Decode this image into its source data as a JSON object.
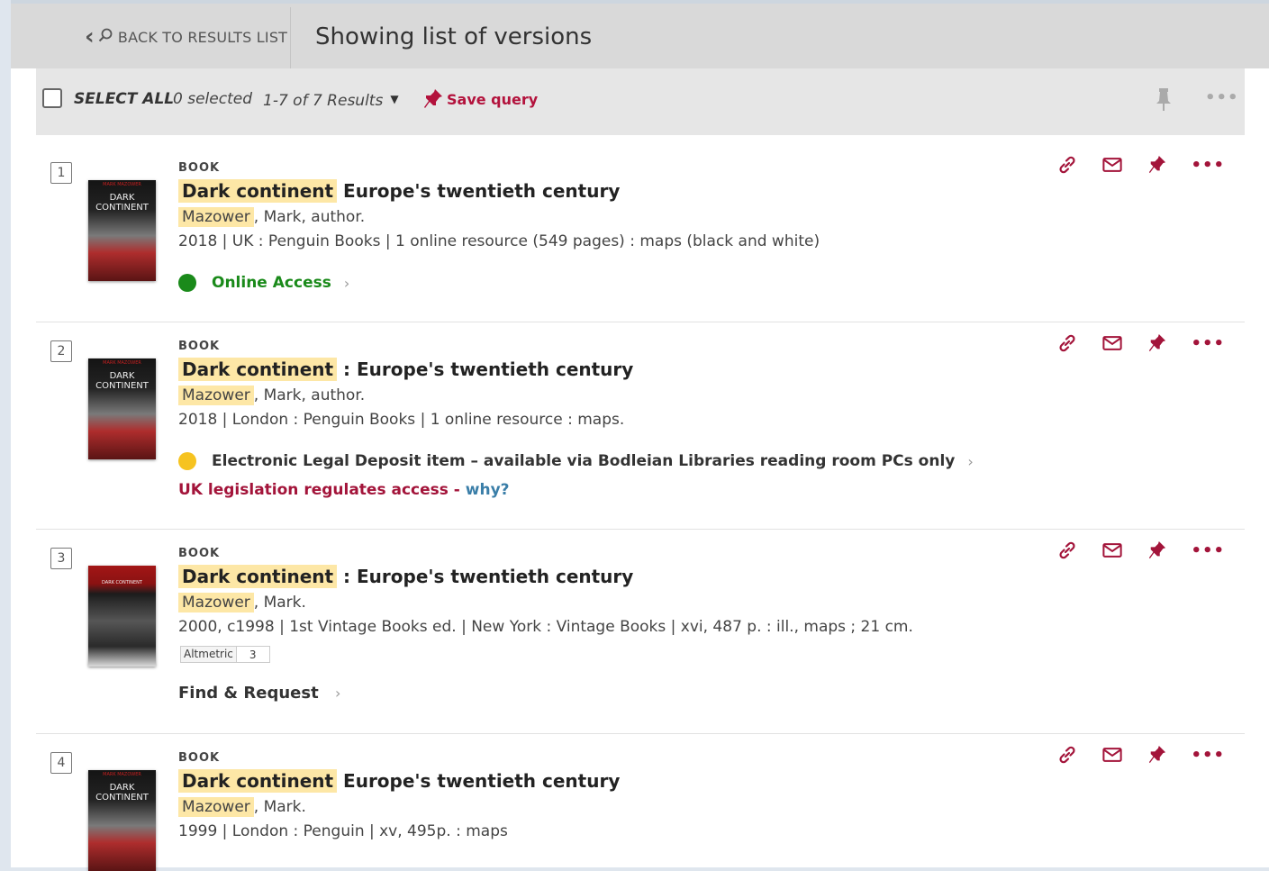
{
  "header": {
    "back_label": "BACK TO RESULTS LIST",
    "title": "Showing list of versions"
  },
  "toolbar": {
    "select_all": "SELECT ALL",
    "selected": "0 selected",
    "results": "1-7 of 7 Results",
    "save_query": "Save query"
  },
  "results": [
    {
      "number": "1",
      "type": "BOOK",
      "title_highlight": "Dark continent",
      "title_rest": "Europe's twentieth century",
      "author_highlight": "Mazower",
      "author_rest": ", Mark, author.",
      "details": "2018 | UK : Penguin Books | 1 online resource (549 pages) : maps (black and white)",
      "availability": "Online Access",
      "availability_color": "#1a8a1a"
    },
    {
      "number": "2",
      "type": "BOOK",
      "title_highlight": "Dark continent",
      "title_rest": ": Europe's twentieth century",
      "author_highlight": "Mazower",
      "author_rest": ", Mark, author.",
      "details": "2018 | London : Penguin Books | 1 online resource : maps.",
      "availability": "Electronic Legal Deposit item – available via Bodleian Libraries reading room PCs only",
      "availability_color": "#f6c320",
      "legal_text": "UK legislation regulates access - ",
      "legal_link": "why?"
    },
    {
      "number": "3",
      "type": "BOOK",
      "title_highlight": "Dark continent",
      "title_rest": ": Europe's twentieth century",
      "author_highlight": "Mazower",
      "author_rest": ", Mark.",
      "details": "2000, c1998 | 1st Vintage Books ed. | New York : Vintage Books | xvi, 487 p. : ill., maps ; 21 cm.",
      "altmetric_label": "Altmetric",
      "altmetric_score": "3",
      "action": "Find & Request"
    },
    {
      "number": "4",
      "type": "BOOK",
      "title_highlight": "Dark continent",
      "title_rest": "Europe's twentieth century",
      "author_highlight": "Mazower",
      "author_rest": ", Mark.",
      "details": "1999 | London : Penguin | xv, 495p. : maps"
    }
  ],
  "covers": {
    "dark_title": "DARK\nCONTINENT",
    "author_band": "MARK MAZOWER"
  },
  "colors": {
    "accent": "#b3123c",
    "highlight": "#fde7a6",
    "online": "#1a8a1a",
    "legal_deposit": "#f6c320",
    "link": "#3a7ea8"
  }
}
